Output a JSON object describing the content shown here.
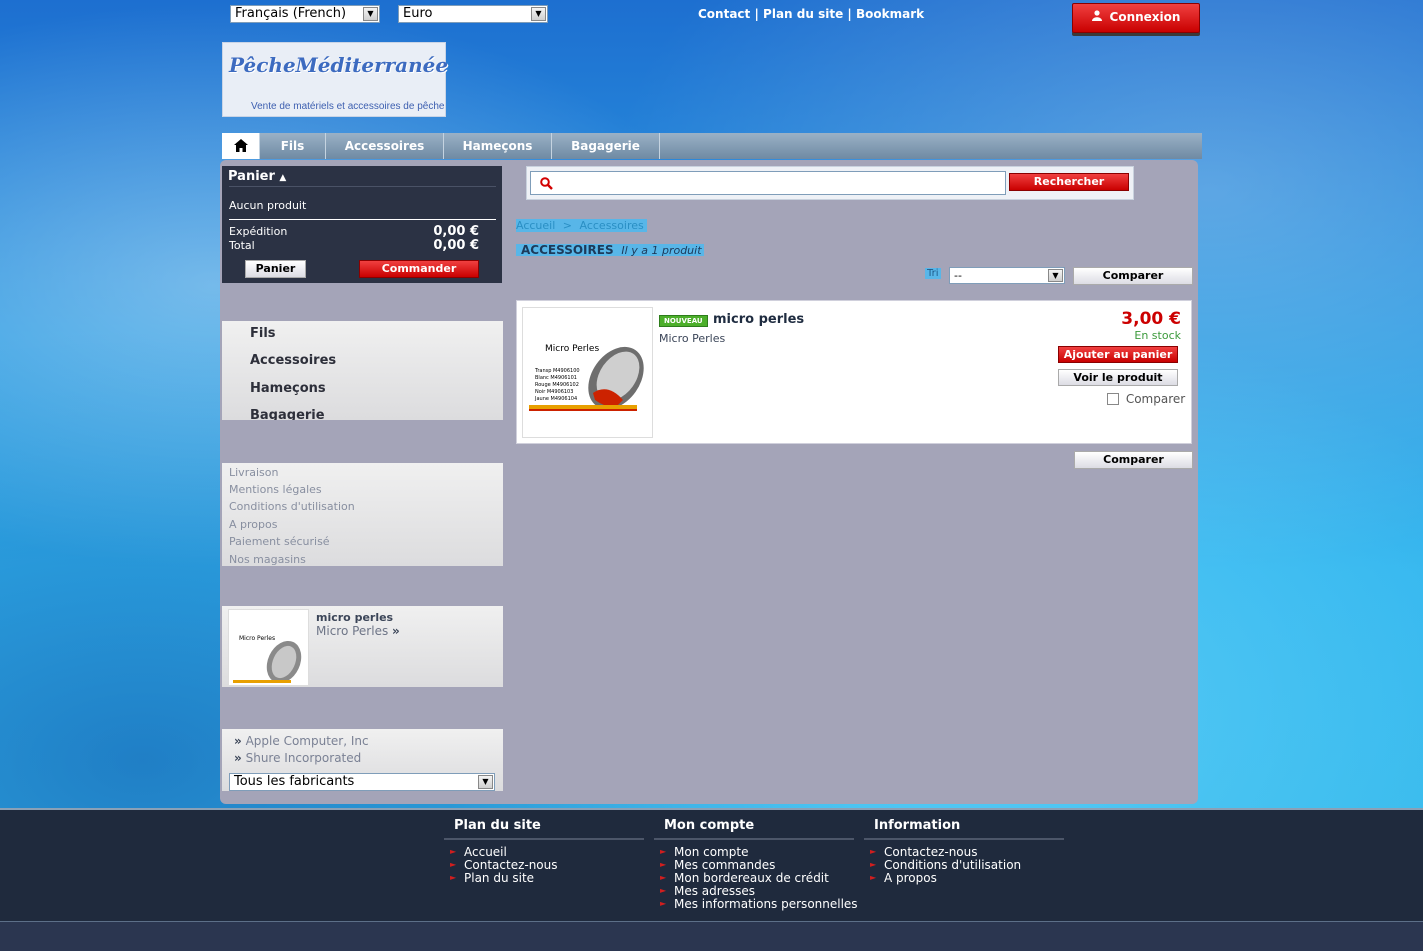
{
  "topbar": {
    "language": "Français (French)",
    "currency": "Euro",
    "links": [
      "Contact",
      "Plan du site",
      "Bookmark"
    ],
    "separator": "|",
    "login_label": "Connexion"
  },
  "logo": {
    "brand": "PêcheMéditerranée",
    "tagline": "Vente de matériels et accessoires de pêche"
  },
  "nav": {
    "items": [
      "Fils",
      "Accessoires",
      "Hameçons",
      "Bagagerie"
    ]
  },
  "cart": {
    "title": "Panier",
    "empty": "Aucun produit",
    "shipping_label": "Expédition",
    "shipping_value": "0,00 €",
    "total_label": "Total",
    "total_value": "0,00 €",
    "cart_button": "Panier",
    "order_button": "Commander"
  },
  "categories": [
    "Fils",
    "Accessoires",
    "Hameçons",
    "Bagagerie"
  ],
  "info_links": [
    "Livraison",
    "Mentions légales",
    "Conditions d'utilisation",
    "A propos",
    "Paiement sécurisé",
    "Nos magasins"
  ],
  "viewed": {
    "name": "micro perles",
    "desc": "Micro Perles"
  },
  "manufacturers": {
    "items": [
      "Apple Computer, Inc",
      "Shure Incorporated"
    ],
    "select": "Tous les fabricants"
  },
  "search": {
    "button": "Rechercher",
    "value": ""
  },
  "breadcrumb": {
    "home": "Accueil",
    "separator": ">",
    "current": "Accessoires"
  },
  "category": {
    "title": "ACCESSOIRES",
    "count": "Il y a 1 produit",
    "sort_label": "Tri",
    "sort_value": "--",
    "compare_label": "Comparer"
  },
  "product": {
    "badge": "NOUVEAU",
    "name": "micro perles",
    "desc": "Micro Perles",
    "price": "3,00 €",
    "stock": "En stock",
    "add_button": "Ajouter au panier",
    "view_button": "Voir le produit",
    "compare_label": "Comparer",
    "image": {
      "title": "Micro Perles",
      "rows": [
        "Transp  M4906100",
        "Blanc   M4906101",
        "Rouge   M4906102",
        "Noir    M4906103",
        "Jaune   M4906104"
      ]
    }
  },
  "footer": {
    "columns": [
      {
        "title": "Plan du site",
        "links": [
          "Accueil",
          "Contactez-nous",
          "Plan du site"
        ]
      },
      {
        "title": "Mon compte",
        "links": [
          "Mon compte",
          "Mes commandes",
          "Mon bordereaux de crédit",
          "Mes adresses",
          "Mes informations personnelles"
        ]
      },
      {
        "title": "Information",
        "links": [
          "Contactez-nous",
          "Conditions d'utilisation",
          "A propos"
        ]
      }
    ]
  },
  "colors": {
    "accent_red": "#d20000",
    "panel": "#a4a4b8",
    "dark": "#2b3244",
    "price": "#cc0000",
    "stock": "#3b9a3b",
    "badge": "#4caf2a"
  },
  "icons": {
    "home": "home-icon",
    "user": "user-icon",
    "search": "search-icon",
    "caret": "caret-up-icon",
    "chevrons": "double-chevron-icon"
  }
}
